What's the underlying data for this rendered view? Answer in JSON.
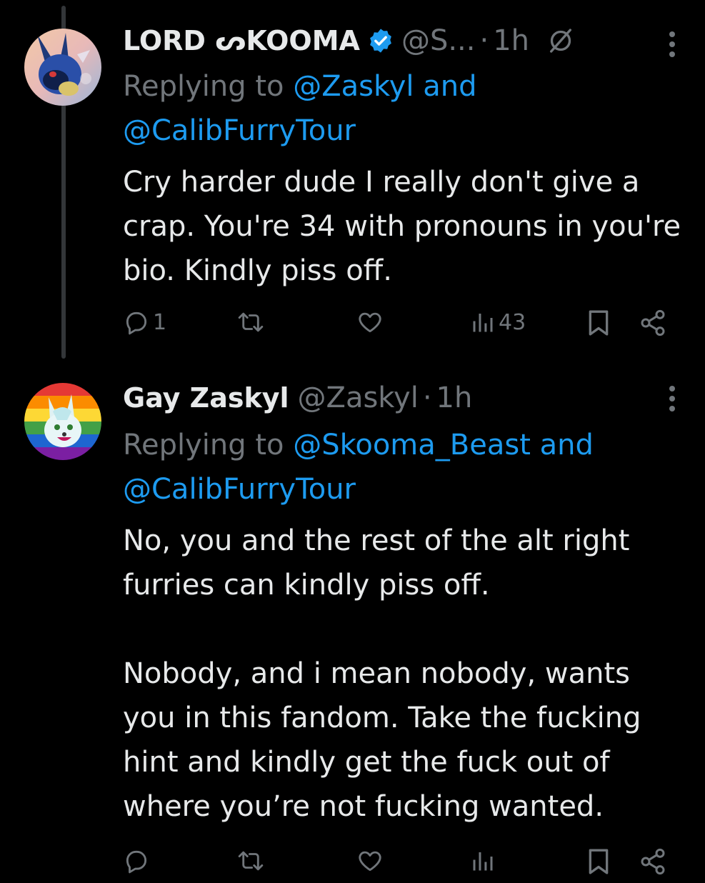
{
  "colors": {
    "background": "#000000",
    "text_primary": "#e7e9ea",
    "text_secondary": "#71767b",
    "link": "#1d9bf0",
    "verified_badge": "#1d9bf0",
    "thread_line": "#333639"
  },
  "tweets": [
    {
      "display_name": "LORD ᔕKOOMA",
      "handle": "@S...",
      "separator": "·",
      "time": "1h",
      "verified": true,
      "edited_icon": "edited-icon",
      "replying_prefix": "Replying to",
      "replying_mention_1": "@Zaskyl",
      "replying_and": "and",
      "replying_mention_2": "@CalibFurryTour",
      "text": "Cry harder dude I really don't give a crap. You're 34 with pronouns in you're bio. Kindly piss off.",
      "reply_count": "1",
      "retweet_count": "",
      "like_count": "",
      "view_count": "43"
    },
    {
      "display_name": "Gay Zaskyl",
      "handle": "@Zaskyl",
      "separator": "·",
      "time": "1h",
      "verified": false,
      "replying_prefix": "Replying to",
      "replying_mention_1": "@Skooma_Beast",
      "replying_and": "and",
      "replying_mention_2": "@CalibFurryTour",
      "text": "No, you and the rest of the alt right furries can kindly piss off.\n\nNobody, and i mean nobody, wants you in this fandom. Take the fucking hint and kindly get the fuck out of where you’re not fucking wanted."
    }
  ]
}
